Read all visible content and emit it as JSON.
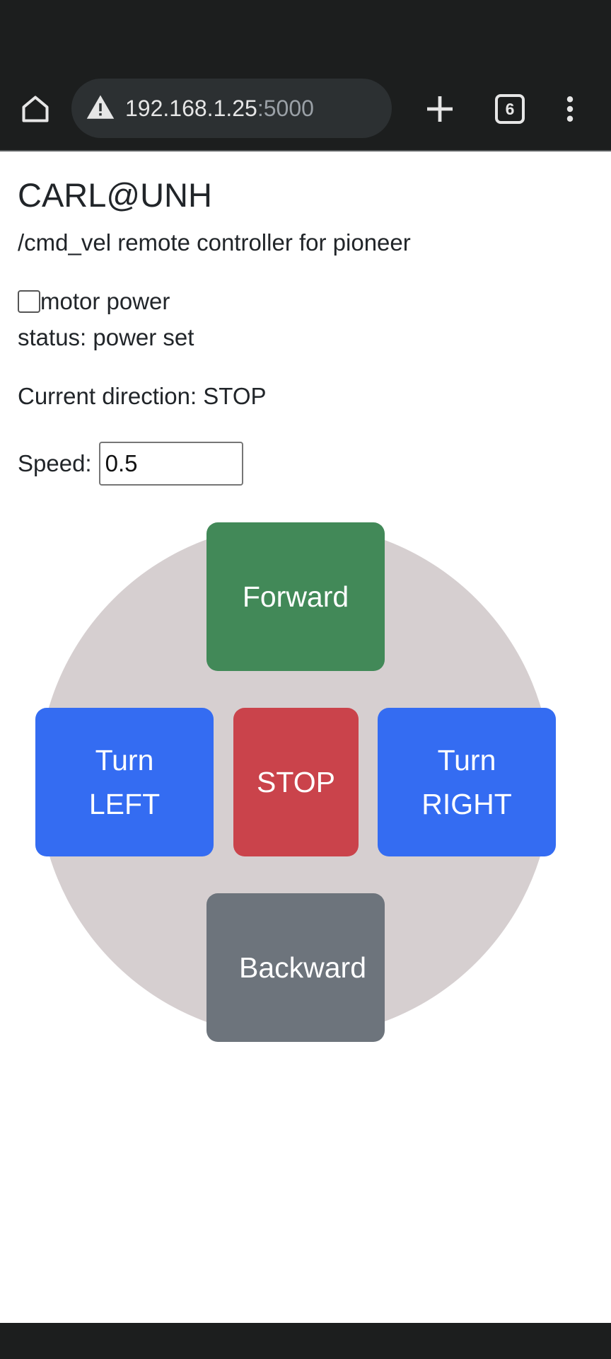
{
  "browser": {
    "url_host": "192.168.1.25",
    "url_port": ":5000",
    "tab_count": "6"
  },
  "page": {
    "title": "CARL@UNH",
    "subtitle": "/cmd_vel remote controller for pioneer",
    "motor_power_label": "motor power",
    "motor_power_checked": false,
    "status_text": "status: power set",
    "direction_text": "Current direction: STOP",
    "speed_label": "Speed:",
    "speed_value": "0.5"
  },
  "controls": {
    "forward_label": "Forward",
    "left_line1": "Turn",
    "left_line2": "LEFT",
    "stop_label": "STOP",
    "right_line1": "Turn",
    "right_line2": "RIGHT",
    "backward_label": "Backward"
  },
  "colors": {
    "forward": "#428958",
    "turn": "#346cf2",
    "stop": "#ca434b",
    "backward": "#6d747c",
    "pad": "#d6cfd0",
    "browser_chrome": "#1c1e1e"
  },
  "icons": {
    "home": "home-icon",
    "warning": "warning-icon",
    "new_tab": "plus-icon",
    "tabs": "tab-switcher-icon",
    "menu": "more-vert-icon"
  }
}
